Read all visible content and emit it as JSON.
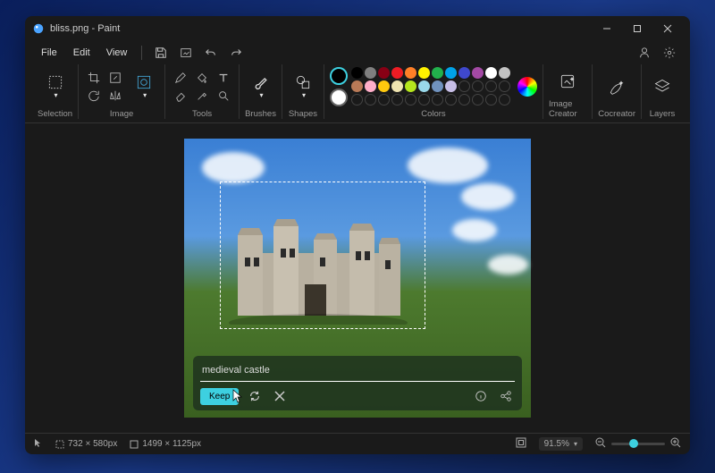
{
  "title": "bliss.png - Paint",
  "menu": {
    "file": "File",
    "edit": "Edit",
    "view": "View"
  },
  "ribbon": {
    "selection": "Selection",
    "image": "Image",
    "tools": "Tools",
    "brushes": "Brushes",
    "shapes": "Shapes",
    "colors": "Colors",
    "image_creator": "Image Creator",
    "cocreator": "Cocreator",
    "layers": "Layers"
  },
  "palette_primary": "#000000",
  "palette_secondary": "#ffffff",
  "palette": [
    "#000000",
    "#7f7f7f",
    "#880015",
    "#ed1c24",
    "#ff7f27",
    "#fff200",
    "#22b14c",
    "#00a2e8",
    "#3f48cc",
    "#a349a4",
    "#ffffff",
    "#c3c3c3",
    "#b97a57",
    "#ffaec9",
    "#ffc90e",
    "#efe4b0",
    "#b5e61d",
    "#99d9ea",
    "#7092be",
    "#c8bfe7",
    "#",
    "#",
    "#",
    "#",
    "#",
    "#",
    "#",
    "#",
    "#",
    "#",
    "#",
    "#",
    "#",
    "#",
    "#",
    "#"
  ],
  "prompt": {
    "value": "medieval castle",
    "keep": "Keep"
  },
  "status": {
    "sel_size": "732 × 580px",
    "canvas_size": "1499 × 1125px",
    "zoom": "91.5%"
  }
}
